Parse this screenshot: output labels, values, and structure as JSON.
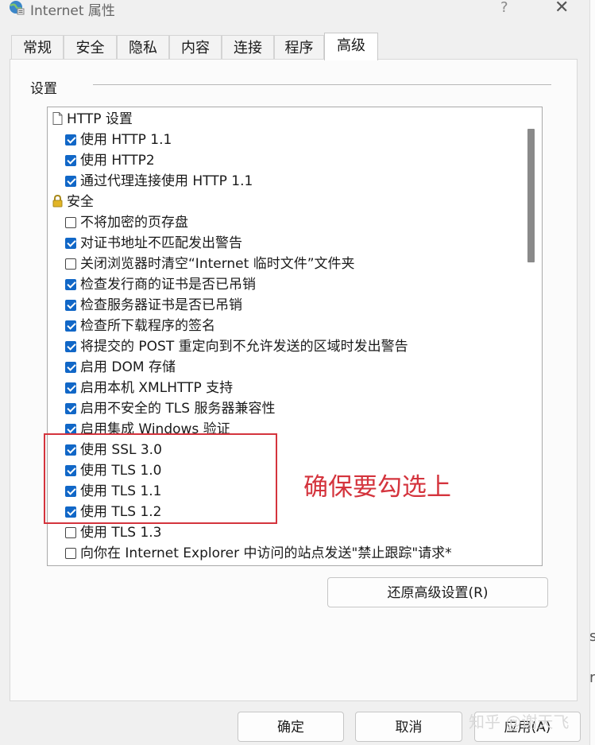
{
  "window": {
    "title": "Internet 属性",
    "help": "?",
    "close": "✕"
  },
  "tabs": [
    {
      "label": "常规"
    },
    {
      "label": "安全"
    },
    {
      "label": "隐私"
    },
    {
      "label": "内容"
    },
    {
      "label": "连接"
    },
    {
      "label": "程序"
    },
    {
      "label": "高级",
      "selected": true
    }
  ],
  "settings": {
    "group_label": "设置",
    "rows": [
      {
        "type": "heading",
        "icon": "page-icon",
        "label": "HTTP 设置"
      },
      {
        "type": "item",
        "checked": true,
        "label": "使用 HTTP 1.1"
      },
      {
        "type": "item",
        "checked": true,
        "label": "使用 HTTP2"
      },
      {
        "type": "item",
        "checked": true,
        "label": "通过代理连接使用 HTTP 1.1"
      },
      {
        "type": "heading",
        "icon": "lock-icon",
        "label": "安全"
      },
      {
        "type": "item",
        "checked": false,
        "label": "不将加密的页存盘"
      },
      {
        "type": "item",
        "checked": true,
        "label": "对证书地址不匹配发出警告"
      },
      {
        "type": "item",
        "checked": false,
        "label": "关闭浏览器时清空“Internet 临时文件”文件夹"
      },
      {
        "type": "item",
        "checked": true,
        "label": "检查发行商的证书是否已吊销"
      },
      {
        "type": "item",
        "checked": true,
        "label": "检查服务器证书是否已吊销"
      },
      {
        "type": "item",
        "checked": true,
        "label": "检查所下载程序的签名"
      },
      {
        "type": "item",
        "checked": true,
        "label": "将提交的 POST 重定向到不允许发送的区域时发出警告"
      },
      {
        "type": "item",
        "checked": true,
        "label": "启用 DOM 存储"
      },
      {
        "type": "item",
        "checked": true,
        "label": "启用本机 XMLHTTP 支持"
      },
      {
        "type": "item",
        "checked": true,
        "label": "启用不安全的 TLS 服务器兼容性"
      },
      {
        "type": "item",
        "checked": true,
        "label": "启用集成 Windows 验证"
      },
      {
        "type": "item",
        "checked": true,
        "label": "使用 SSL 3.0"
      },
      {
        "type": "item",
        "checked": true,
        "label": "使用 TLS 1.0"
      },
      {
        "type": "item",
        "checked": true,
        "label": "使用 TLS 1.1"
      },
      {
        "type": "item",
        "checked": true,
        "label": "使用 TLS 1.2"
      },
      {
        "type": "item",
        "checked": false,
        "label": "使用 TLS 1.3"
      },
      {
        "type": "item",
        "checked": false,
        "label": "向你在 Internet Explorer 中访问的站点发送\"禁止跟踪\"请求*"
      }
    ]
  },
  "annotation": {
    "text": "确保要勾选上",
    "color": "#d4343d"
  },
  "buttons": {
    "restore": "还原高级设置(R)",
    "ok": "确定",
    "cancel": "取消",
    "apply": "应用(A)"
  },
  "watermark": "知乎 @谢天飞",
  "colors": {
    "checkbox_checked": "#1167c7",
    "annotation": "#d4343d"
  }
}
